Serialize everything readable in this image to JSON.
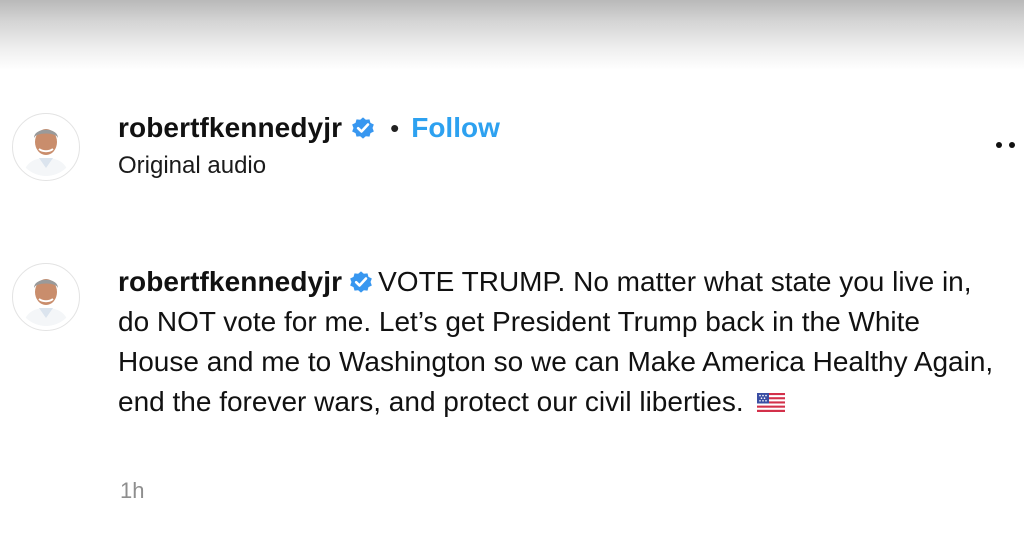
{
  "header": {
    "username": "robertfkennedyjr",
    "separator": "•",
    "follow_label": "Follow",
    "audio_label": "Original audio",
    "verified_icon": "verified-badge-icon",
    "more_icon": "more-options-icon"
  },
  "comment": {
    "username": "robertfkennedyjr",
    "text": "VOTE TRUMP. No matter what state you live in, do NOT vote for me. Let’s get President Trump back in the White House and me to Washington so we can Make America Healthy Again, end the forever wars, and protect our civil liberties.",
    "emoji_icon": "us-flag-icon",
    "timestamp": "1h"
  },
  "colors": {
    "follow_blue": "#2da1f0",
    "verified_blue": "#3897f0",
    "timestamp_gray": "#8e8e8e"
  }
}
